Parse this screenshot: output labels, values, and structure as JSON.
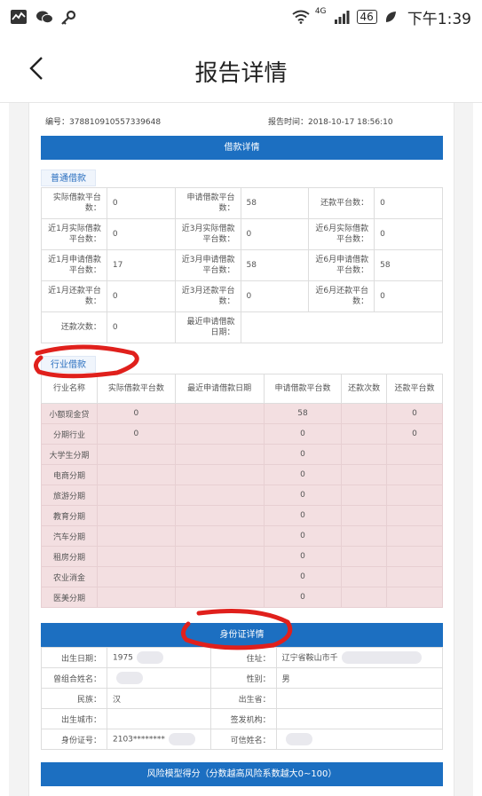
{
  "status": {
    "network": "4G",
    "battery": "46",
    "time": "下午1:39"
  },
  "header": {
    "title": "报告详情"
  },
  "meta": {
    "id_label": "编号：378810910557339648",
    "time_label": "报告时间：2018-10-17 18:56:10"
  },
  "loan_section": {
    "title": "借款详情",
    "general_tab": "普通借款",
    "general_rows": [
      [
        [
          "实际借款平台数：",
          "0"
        ],
        [
          "申请借款平台数：",
          "58"
        ],
        [
          "还款平台数：",
          "0"
        ]
      ],
      [
        [
          "近1月实际借款平台数：",
          "0"
        ],
        [
          "近3月实际借款平台数：",
          "0"
        ],
        [
          "近6月实际借款平台数：",
          "0"
        ]
      ],
      [
        [
          "近1月申请借款平台数：",
          "17"
        ],
        [
          "近3月申请借款平台数：",
          "58"
        ],
        [
          "近6月申请借款平台数：",
          "58"
        ]
      ],
      [
        [
          "近1月还款平台数：",
          "0"
        ],
        [
          "近3月还款平台数：",
          "0"
        ],
        [
          "近6月还款平台数：",
          "0"
        ]
      ],
      [
        [
          "还款次数：",
          "0"
        ],
        [
          "最近申请借款日期：",
          ""
        ]
      ]
    ],
    "industry_tab": "行业借款",
    "industry_headers": [
      "行业名称",
      "实际借款平台数",
      "最近申请借款日期",
      "申请借款平台数",
      "还款次数",
      "还款平台数"
    ],
    "industry_rows": [
      [
        "小额现金贷",
        "0",
        "",
        "58",
        "",
        "0"
      ],
      [
        "分期行业",
        "0",
        "",
        "0",
        "",
        "0"
      ],
      [
        "大学生分期",
        "",
        "",
        "0",
        "",
        ""
      ],
      [
        "电商分期",
        "",
        "",
        "0",
        "",
        ""
      ],
      [
        "旅游分期",
        "",
        "",
        "0",
        "",
        ""
      ],
      [
        "教育分期",
        "",
        "",
        "0",
        "",
        ""
      ],
      [
        "汽车分期",
        "",
        "",
        "0",
        "",
        ""
      ],
      [
        "租房分期",
        "",
        "",
        "0",
        "",
        ""
      ],
      [
        "农业消金",
        "",
        "",
        "0",
        "",
        ""
      ],
      [
        "医美分期",
        "",
        "",
        "0",
        "",
        ""
      ]
    ]
  },
  "identity_section": {
    "title": "身份证详情",
    "rows": [
      [
        [
          "出生日期：",
          "1975"
        ],
        [
          "住址：",
          "辽宁省鞍山市千"
        ]
      ],
      [
        [
          "曾组合姓名：",
          ""
        ],
        [
          "性别：",
          "男"
        ]
      ],
      [
        [
          "民族：",
          "汉"
        ],
        [
          "出生省：",
          ""
        ]
      ],
      [
        [
          "出生城市：",
          ""
        ],
        [
          "签发机构：",
          ""
        ]
      ],
      [
        [
          "身份证号：",
          "2103********"
        ],
        [
          "可信姓名：",
          ""
        ]
      ]
    ]
  },
  "risk_section": {
    "title": "风险模型得分（分数越高风险系数越大0~100）"
  }
}
